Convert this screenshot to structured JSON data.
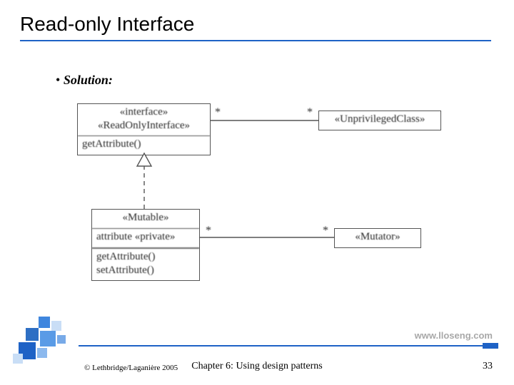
{
  "title": "Read-only Interface",
  "bullet": "Solution:",
  "uml": {
    "interface": {
      "stereotype": "«interface»",
      "name": "«ReadOnlyInterface»",
      "ops": "getAttribute()"
    },
    "mutable": {
      "name": "«Mutable»",
      "attr": "attribute «private»",
      "op1": "getAttribute()",
      "op2": "setAttribute()"
    },
    "unpriv": {
      "name": "«UnprivilegedClass»"
    },
    "mutator": {
      "name": "«Mutator»"
    },
    "mult": {
      "a1": "*",
      "a2": "*",
      "a3": "*",
      "a4": "*"
    }
  },
  "footer": {
    "url": "www.lloseng.com",
    "copyright": "© Lethbridge/Laganière 2005",
    "chapter": "Chapter 6: Using design patterns",
    "page": "33"
  }
}
